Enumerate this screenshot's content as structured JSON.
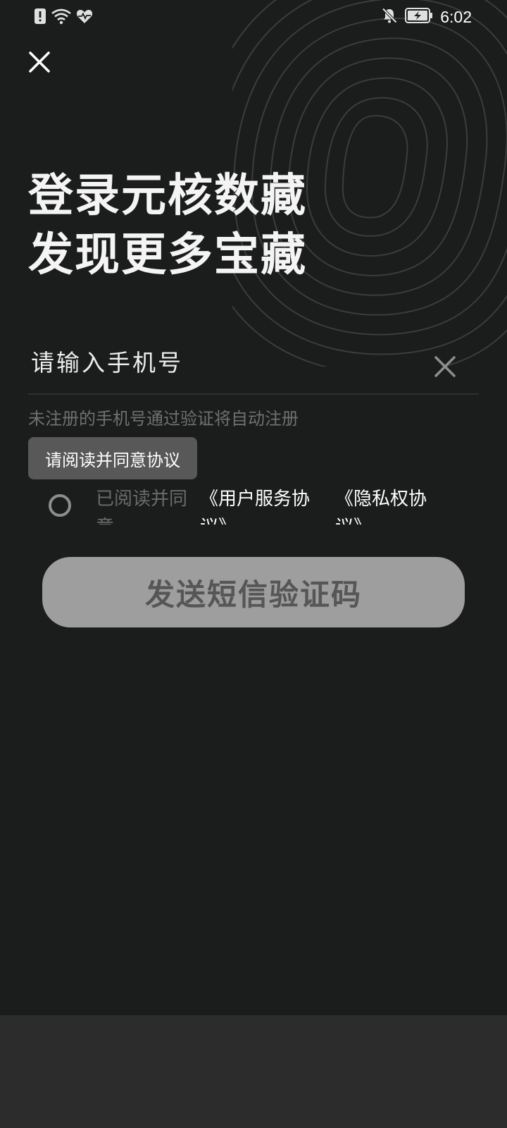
{
  "status_bar": {
    "time": "6:02",
    "left_icons": [
      "alert-badge-icon",
      "wifi-icon",
      "health-heart-icon"
    ],
    "right_icons": [
      "notifications-off-icon",
      "battery-charging-icon"
    ]
  },
  "header": {
    "close_icon": "close-icon"
  },
  "title": {
    "line1": "登录元核数藏",
    "line2": "发现更多宝藏"
  },
  "phone_field": {
    "placeholder": "请输入手机号",
    "value": "",
    "clear_icon": "clear-icon"
  },
  "hint": "未注册的手机号通过验证将自动注册",
  "toast": "请阅读并同意协议",
  "agreement": {
    "checked": false,
    "prefix": "已阅读并同意",
    "service_link": "《用户服务协议》",
    "privacy_link": "《隐私权协议》"
  },
  "send_button": "发送短信验证码",
  "colors": {
    "background": "#1b1c1c",
    "bottom_area": "#2c2c2c",
    "button_disabled_bg": "#9e9e9e",
    "button_disabled_text": "#565656",
    "hint_text": "#6f7070",
    "toast_bg": "#585858"
  }
}
